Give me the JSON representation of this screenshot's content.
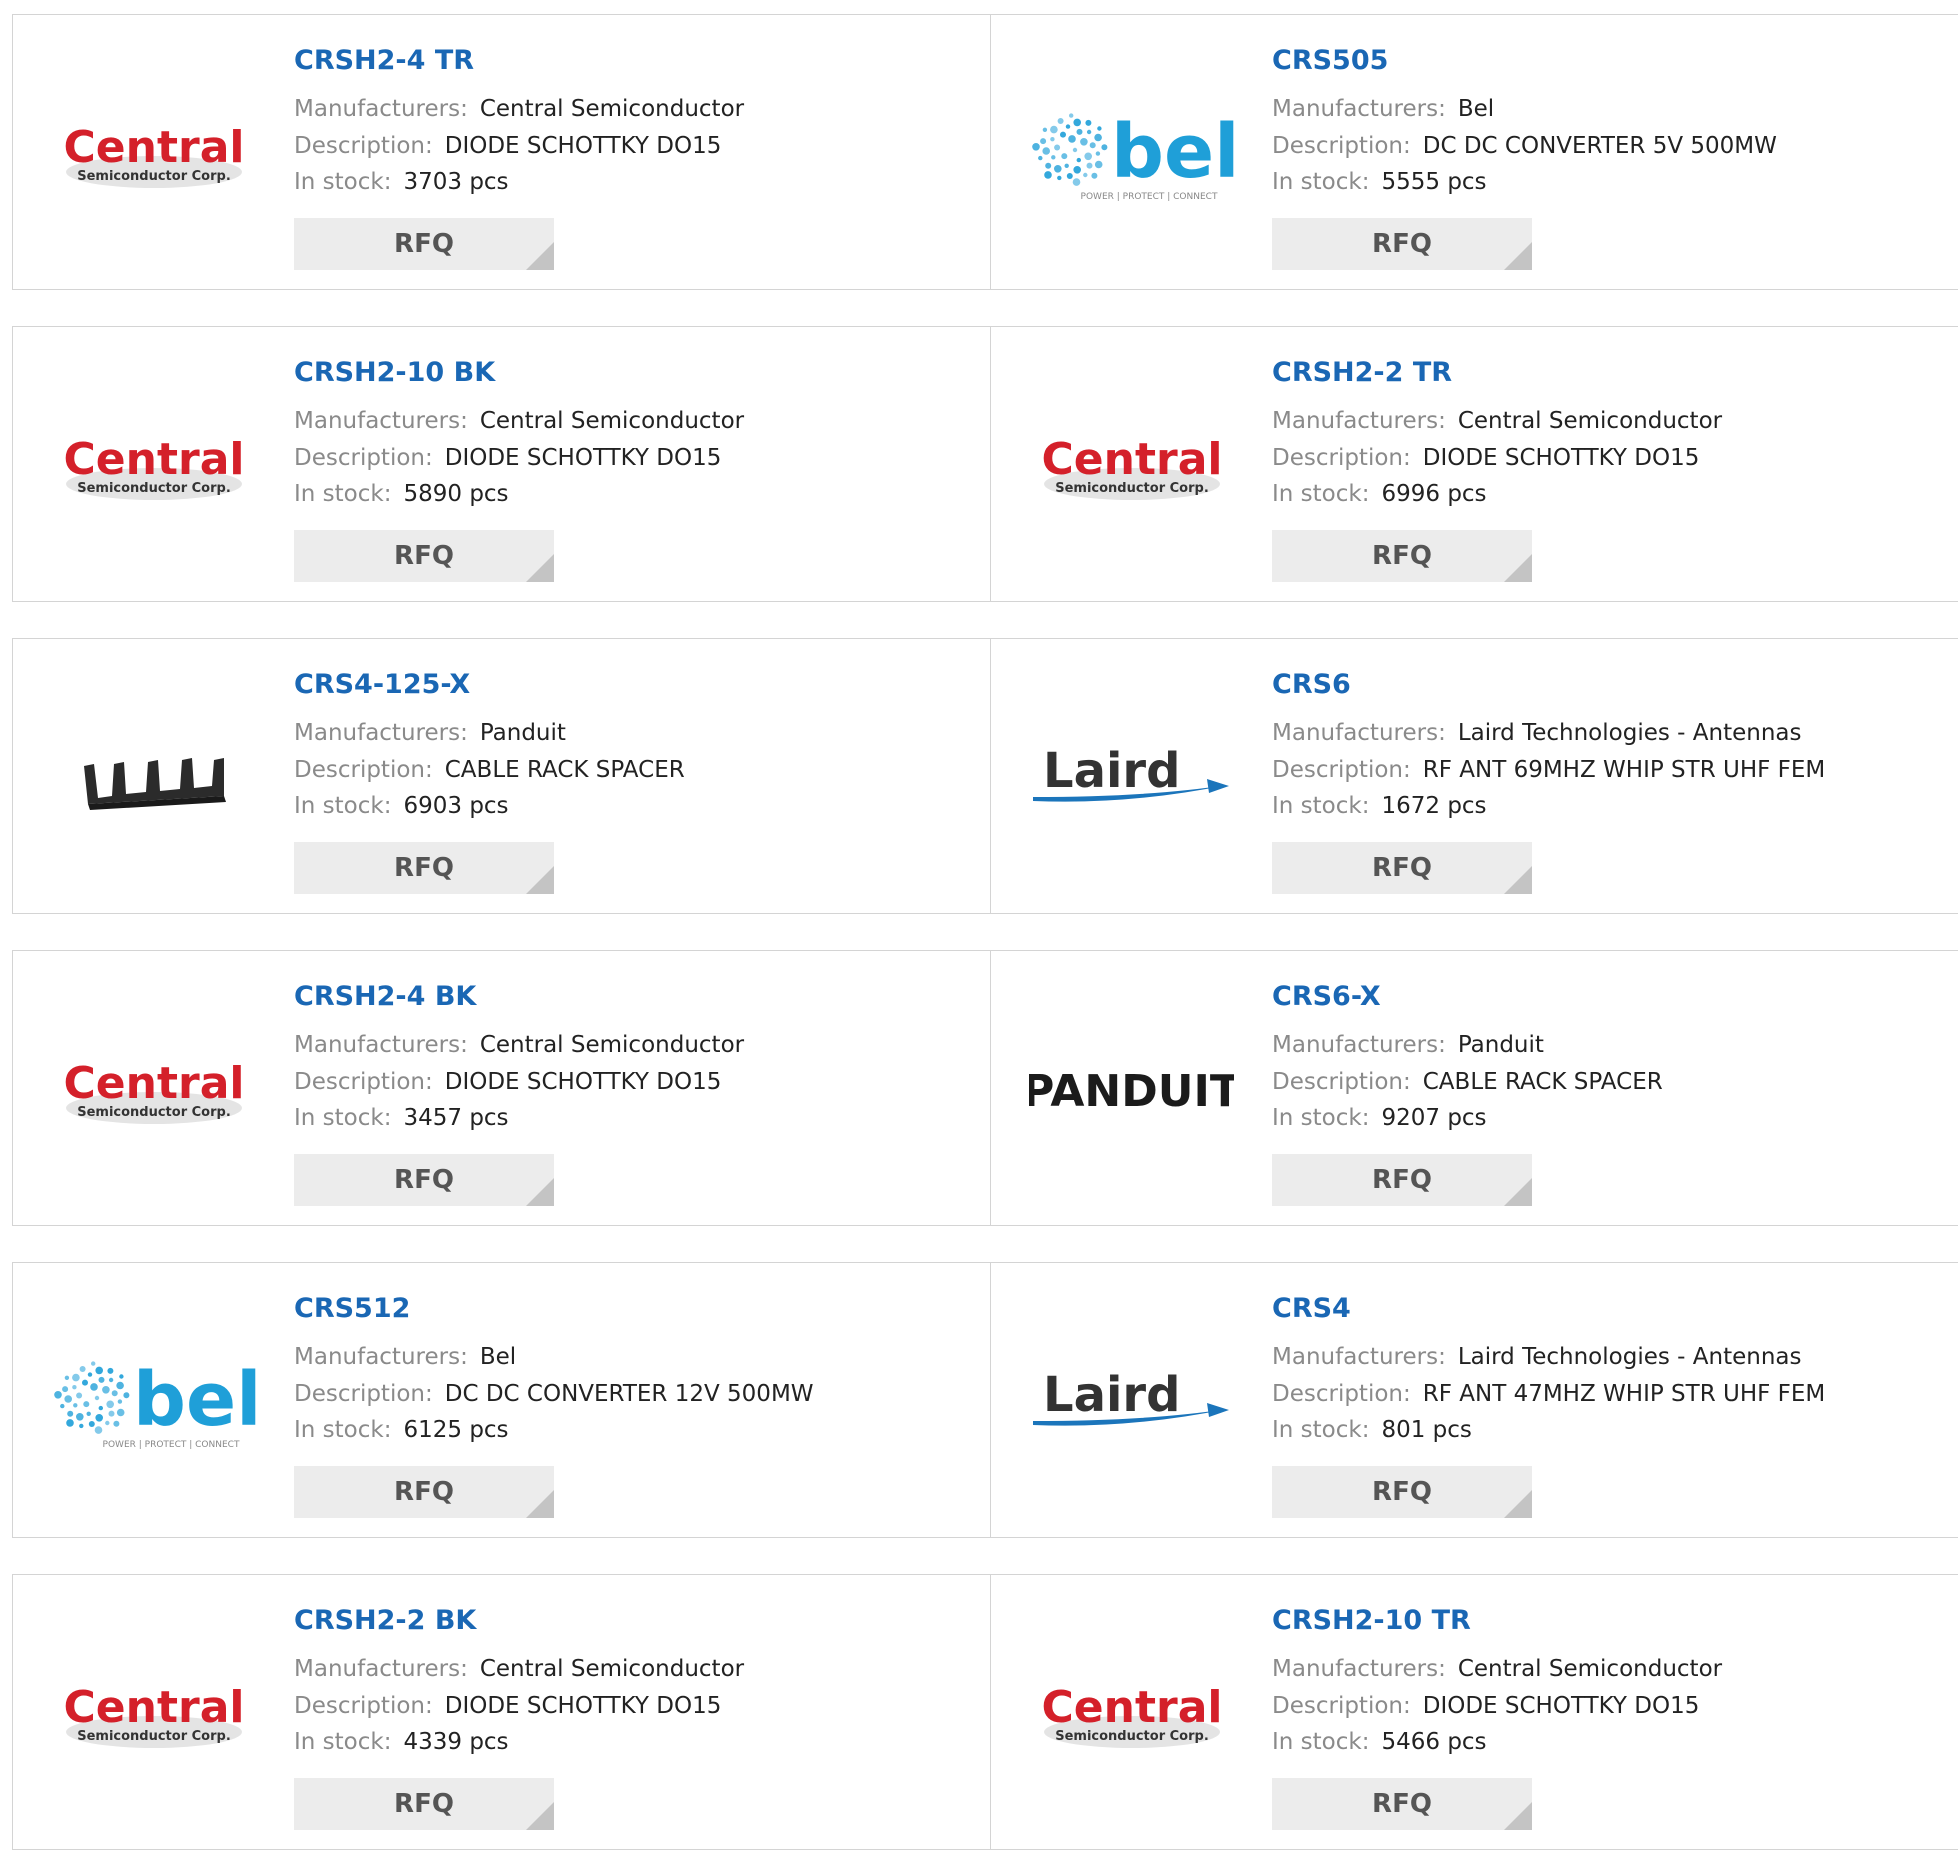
{
  "labels": {
    "manufacturers": "Manufacturers:",
    "description": "Description:",
    "in_stock": "In stock:",
    "rfq": "RFQ"
  },
  "brand_colors": {
    "part_link": "#1a67b4",
    "central_red": "#d4202a",
    "bel_blue": "#1f9fd8",
    "laird_blue": "#1b75bb"
  },
  "logos": {
    "central": {
      "line1": "Central",
      "line2": "Semiconductor Corp.",
      "icon": "central-logo"
    },
    "bel": {
      "word": "bel",
      "tagline": "POWER | PROTECT | CONNECT",
      "icon": "bel-logo"
    },
    "laird": {
      "word": "Laird",
      "icon": "laird-logo"
    },
    "panduit": {
      "word": "PANDUIT",
      "icon": "panduit-logo"
    },
    "rack": {
      "icon": "cable-rack-spacer-image"
    }
  },
  "products": [
    {
      "part": "CRSH2-4 TR",
      "manufacturer": "Central Semiconductor",
      "description": "DIODE SCHOTTKY DO15",
      "stock": "3703 pcs",
      "logo": "central"
    },
    {
      "part": "CRS505",
      "manufacturer": "Bel",
      "description": "DC DC CONVERTER 5V 500MW",
      "stock": "5555 pcs",
      "logo": "bel"
    },
    {
      "part": "CRSH2-10 BK",
      "manufacturer": "Central Semiconductor",
      "description": "DIODE SCHOTTKY DO15",
      "stock": "5890 pcs",
      "logo": "central"
    },
    {
      "part": "CRSH2-2 TR",
      "manufacturer": "Central Semiconductor",
      "description": "DIODE SCHOTTKY DO15",
      "stock": "6996 pcs",
      "logo": "central"
    },
    {
      "part": "CRS4-125-X",
      "manufacturer": "Panduit",
      "description": "CABLE RACK SPACER",
      "stock": "6903 pcs",
      "logo": "rack"
    },
    {
      "part": "CRS6",
      "manufacturer": "Laird Technologies - Antennas",
      "description": "RF ANT 69MHZ WHIP STR UHF FEM",
      "stock": "1672 pcs",
      "logo": "laird"
    },
    {
      "part": "CRSH2-4 BK",
      "manufacturer": "Central Semiconductor",
      "description": "DIODE SCHOTTKY DO15",
      "stock": "3457 pcs",
      "logo": "central"
    },
    {
      "part": "CRS6-X",
      "manufacturer": "Panduit",
      "description": "CABLE RACK SPACER",
      "stock": "9207 pcs",
      "logo": "panduit"
    },
    {
      "part": "CRS512",
      "manufacturer": "Bel",
      "description": "DC DC CONVERTER 12V 500MW",
      "stock": "6125 pcs",
      "logo": "bel"
    },
    {
      "part": "CRS4",
      "manufacturer": "Laird Technologies - Antennas",
      "description": "RF ANT 47MHZ WHIP STR UHF FEM",
      "stock": "801 pcs",
      "logo": "laird"
    },
    {
      "part": "CRSH2-2 BK",
      "manufacturer": "Central Semiconductor",
      "description": "DIODE SCHOTTKY DO15",
      "stock": "4339 pcs",
      "logo": "central"
    },
    {
      "part": "CRSH2-10 TR",
      "manufacturer": "Central Semiconductor",
      "description": "DIODE SCHOTTKY DO15",
      "stock": "5466 pcs",
      "logo": "central"
    }
  ]
}
